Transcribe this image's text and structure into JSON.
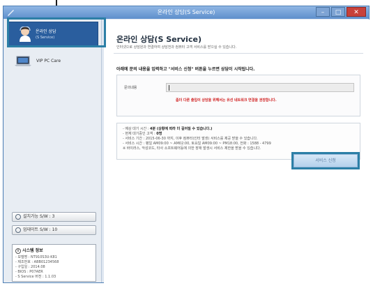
{
  "window": {
    "title": "온라인 상담(S Service)",
    "minimize_glyph": "–",
    "maximize_glyph": "□",
    "close_glyph": "✕"
  },
  "sidebar": {
    "active_item": {
      "label_line1": "온라인 상담",
      "label_line2": "(S Service)",
      "icon": "agent-face-icon"
    },
    "items": [
      {
        "label": "VIP PC Care",
        "icon": "laptop-icon"
      }
    ],
    "buttons": [
      {
        "label": "설치가능 S/W : 3"
      },
      {
        "label": "업데이트 S/W : 10"
      }
    ],
    "system_info": {
      "title": "시스템 정보",
      "rows": [
        "- 모델명 : NT910S3U-K81",
        "- 제조번호 : ABB01234568",
        "- 구입일 : 2014.08",
        "- BIOS : P07AER",
        "- S Service 버전 : 1.1.03"
      ]
    }
  },
  "main": {
    "title": "온라인 상담(S Service)",
    "subtitle": "인터넷으로 상담원과 연결하여 상담전과 컴퓨터 고객 서비스를 받으실 수 있습니다.",
    "instruction": "아래에 문의 내용을 입력하고 \"서비스 신청\" 버튼을 누르면 상담이 시작됩니다.",
    "inquiry_label": "문의내용",
    "inquiry_value": "",
    "warning": "좀더 다른 출입이 상담을 위해서는 유선 네트워크 연결을 권장합니다.",
    "notices": [
      {
        "prefix": "- 예상 대기 시간 : ",
        "bold": "4분 (상황에 따라 더 길어질 수 있습니다.)"
      },
      {
        "prefix": "- 현재 대기중인 고객 : ",
        "bold": "0명"
      },
      {
        "prefix": "- 서비스 기간 : 2015-06-30 까지, 이후 컴퓨터(인터 발생) 서비스를 제공 받을 수 있습니다.",
        "bold": ""
      },
      {
        "prefix": "- 서비스 시간 : 평일 AM09:00 ~ AM02:00, 토요일 AM09:00 ~ PM18:00, 전화 : 1588 - 4799",
        "bold": ""
      },
      {
        "prefix": "  ※ 바이러스, 악성코드, 타사 소프트웨어등에 의한 장애 발생시 서비스 제한을 받을 수 있습니다.",
        "bold": ""
      }
    ],
    "start_button": "서비스 신청"
  }
}
